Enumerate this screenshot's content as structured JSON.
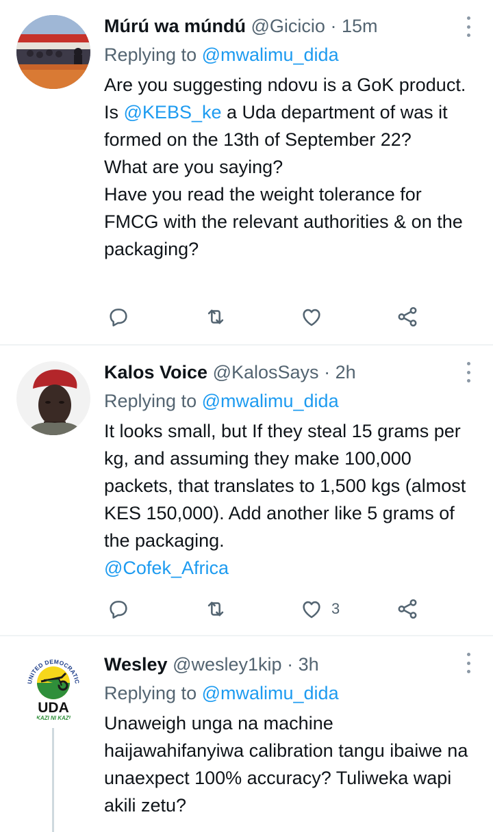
{
  "tweets": [
    {
      "name": "Múrú wa múndú",
      "handle": "@Gicicio",
      "separator": "·",
      "time": "15m",
      "replying_prefix": "Replying to",
      "replying_to": "@mwalimu_dida",
      "lines": [
        "Are you suggesting ndovu is a GoK product.",
        "Is @KEBS_ke a Uda department of was it formed on the 13th of September 22?",
        "What are you saying?",
        "Have you read the weight tolerance for FMCG with the relevant authorities & on the packaging?"
      ],
      "mention_in_body": "@KEBS_ke",
      "likes": ""
    },
    {
      "name": "Kalos Voice",
      "handle": "@KalosSays",
      "separator": "·",
      "time": "2h",
      "replying_prefix": "Replying to",
      "replying_to": "@mwalimu_dida",
      "lines": [
        "It looks small, but If they steal 15 grams per kg, and assuming they make 100,000 packets, that translates to 1,500 kgs (almost KES 150,000). Add another like 5 grams of the packaging."
      ],
      "trailing_mention": "@Cofek_Africa",
      "likes": "3"
    },
    {
      "name": "Wesley",
      "handle": "@wesley1kip",
      "separator": "·",
      "time": "3h",
      "replying_prefix": "Replying to",
      "replying_to": "@mwalimu_dida",
      "lines": [
        "Unaweigh unga na machine haijawahifanyiwa calibration tangu ibaiwe na unaexpect 100% accuracy? Tuliweka wapi akili zetu?"
      ],
      "avatar_logo": {
        "arc_text": "UNITED DEMOCRATIC ALLIANCE",
        "abbr": "UDA",
        "slogan": "KAZI NI KAZI"
      }
    }
  ],
  "icons": {
    "reply": "reply-icon",
    "retweet": "retweet-icon",
    "like": "heart-icon",
    "share": "share-icon",
    "more": "more-options-icon"
  },
  "colors": {
    "link": "#1d9bf0",
    "secondary_text": "#536471",
    "divider": "#eff3f4",
    "brand_yellow": "#f6d71b",
    "brand_green": "#2f8f3a"
  }
}
